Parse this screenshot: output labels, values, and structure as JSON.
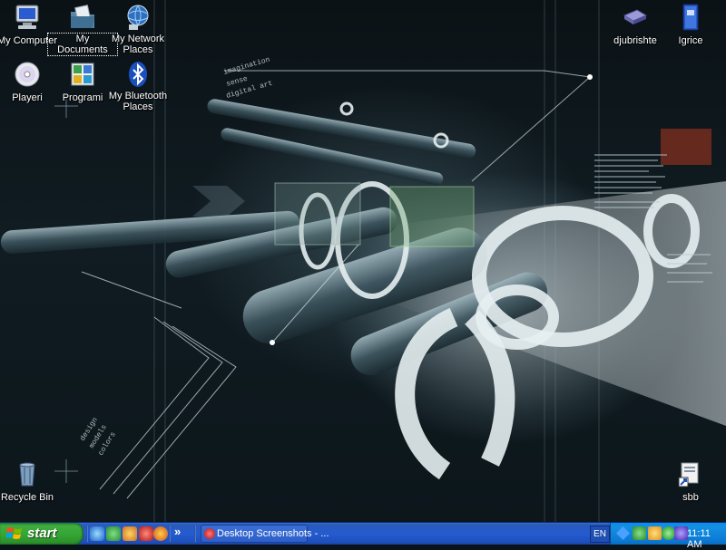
{
  "desktop": {
    "wallpaper_text": {
      "top_lines": [
        "imagination",
        "sense",
        "digital art"
      ],
      "bottom_lines": [
        "design",
        "models",
        "colors"
      ]
    },
    "icons": [
      {
        "label": "My Computer",
        "icon": "my-computer-icon"
      },
      {
        "label": "My Documents",
        "icon": "my-documents-icon",
        "selected": true
      },
      {
        "label": "My Network Places",
        "icon": "network-places-icon"
      },
      {
        "label": "Playeri",
        "icon": "cd-icon"
      },
      {
        "label": "Programi",
        "icon": "programs-folder-icon"
      },
      {
        "label": "My Bluetooth Places",
        "icon": "bluetooth-icon"
      },
      {
        "label": "djubrishte",
        "icon": "scanner-icon"
      },
      {
        "label": "Igrice",
        "icon": "book-icon"
      },
      {
        "label": "Recycle Bin",
        "icon": "recycle-bin-icon"
      },
      {
        "label": "sbb",
        "icon": "shortcut-icon"
      }
    ]
  },
  "taskbar": {
    "start_label": "start",
    "quick_launch": [
      "ie-icon",
      "msn-icon",
      "winamp-icon",
      "antivirus-icon",
      "firefox-icon"
    ],
    "overflow": "»",
    "task_item": {
      "label": "Desktop Screenshots - ...",
      "icon": "opera-icon"
    },
    "language": "EN",
    "clock": "11:11 AM"
  },
  "colors": {
    "taskbar_blue": "#245bd0",
    "start_green": "#34a534",
    "tray_blue": "#0c7ad4"
  }
}
